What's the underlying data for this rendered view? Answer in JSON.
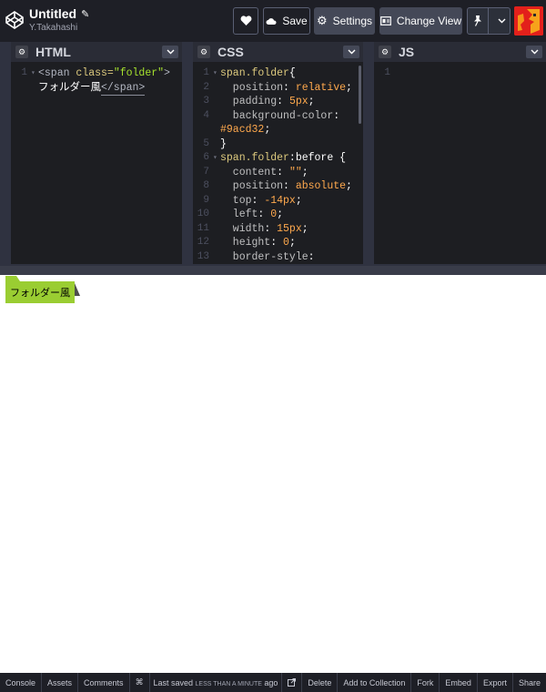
{
  "header": {
    "title": "Untitled",
    "author": "Y.Takahashi",
    "save_label": "Save",
    "settings_label": "Settings",
    "change_view_label": "Change View"
  },
  "panes": {
    "html": {
      "title": "HTML",
      "lines": [
        {
          "num": "1"
        },
        {
          "num": ""
        }
      ],
      "code": {
        "open_tag": "<span",
        "attr": " class=",
        "attr_value": "\"folder\"",
        "close_bracket": ">",
        "text": "フォルダー風",
        "close_tag": "</span>"
      }
    },
    "css": {
      "title": "CSS",
      "lines": [
        {
          "num": "1",
          "sel": "span.folder",
          "rest": "{"
        },
        {
          "num": "2",
          "prop": "  position",
          "colon": ": ",
          "val": "relative",
          "end": ";"
        },
        {
          "num": "3",
          "prop": "  padding",
          "colon": ": ",
          "val": "5px",
          "end": ";"
        },
        {
          "num": "4",
          "prop": "  background-color",
          "colon": ":",
          "val": "",
          "end": ""
        },
        {
          "num": "",
          "prop": "",
          "colon": "",
          "val": "#9acd32",
          "end": ";"
        },
        {
          "num": "5",
          "sel": "",
          "rest": "}"
        },
        {
          "num": "6",
          "sel": "span.folder",
          "rest": ":before {"
        },
        {
          "num": "7",
          "prop": "  content",
          "colon": ": ",
          "val": "\"\"",
          "end": ";"
        },
        {
          "num": "8",
          "prop": "  position",
          "colon": ": ",
          "val": "absolute",
          "end": ";"
        },
        {
          "num": "9",
          "prop": "  top",
          "colon": ": ",
          "val": "-14px",
          "end": ";"
        },
        {
          "num": "10",
          "prop": "  left",
          "colon": ": ",
          "val": "0",
          "end": ";"
        },
        {
          "num": "11",
          "prop": "  width",
          "colon": ": ",
          "val": "15px",
          "end": ";"
        },
        {
          "num": "12",
          "prop": "  height",
          "colon": ": ",
          "val": "0",
          "end": ";"
        },
        {
          "num": "13",
          "prop": "  border-style",
          "colon": ":",
          "val": "",
          "end": ""
        }
      ]
    },
    "js": {
      "title": "JS",
      "lines": [
        {
          "num": "1"
        }
      ]
    }
  },
  "preview": {
    "folder_text": "フォルダー風",
    "folder_color": "#9acd32"
  },
  "footer": {
    "console": "Console",
    "assets": "Assets",
    "comments": "Comments",
    "shortcut": "⌘",
    "last_saved_prefix": "Last saved",
    "last_saved_time": "LESS THAN A MINUTE",
    "last_saved_suffix": "ago",
    "delete": "Delete",
    "add_to_collection": "Add to Collection",
    "fork": "Fork",
    "embed": "Embed",
    "export": "Export",
    "share": "Share"
  },
  "icons": {
    "logo": "codepen-logo-icon",
    "edit": "pencil-icon",
    "heart": "heart-icon",
    "save": "cloud-icon",
    "settings": "gear-icon",
    "change_view": "layout-icon",
    "pin": "pin-icon",
    "chevron": "chevron-down-icon",
    "open_external": "external-link-icon"
  }
}
